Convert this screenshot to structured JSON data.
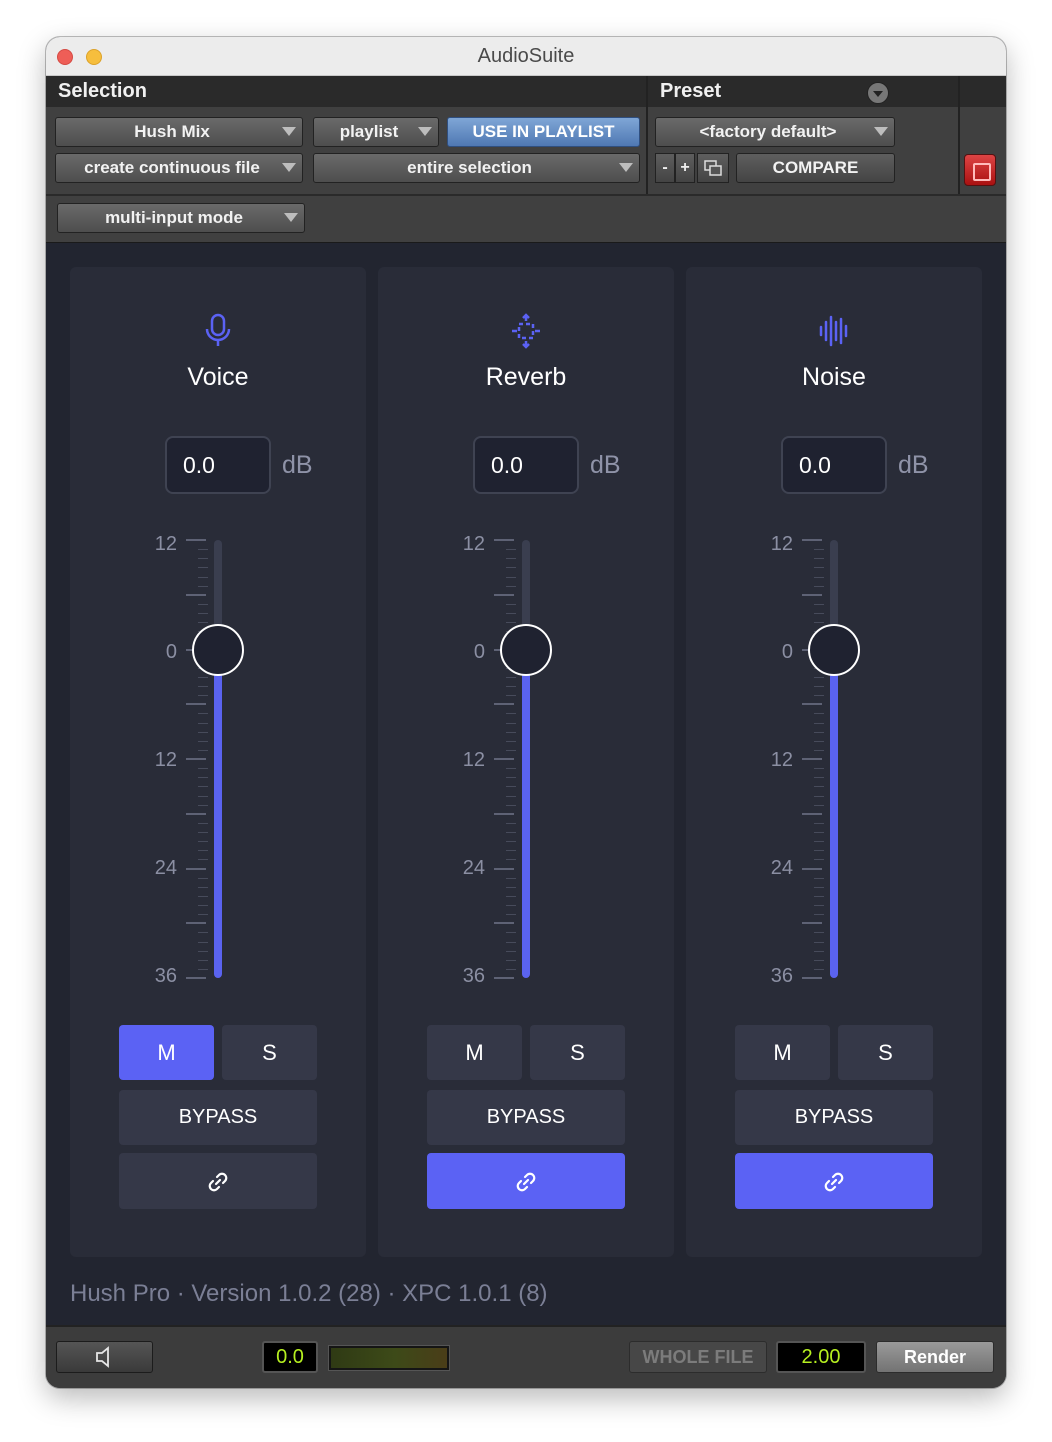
{
  "window": {
    "title": "AudioSuite"
  },
  "selection": {
    "header": "Selection",
    "plugin": "Hush Mix",
    "target": "playlist",
    "use_in_playlist": "USE IN PLAYLIST",
    "file_mode": "create continuous file",
    "processing": "entire selection",
    "input_mode": "multi-input mode"
  },
  "preset": {
    "header": "Preset",
    "name": "<factory default>",
    "minus": "-",
    "plus": "+",
    "compare": "COMPARE"
  },
  "scale_labels": [
    "12",
    "0",
    "12",
    "24",
    "36"
  ],
  "channels": [
    {
      "name": "Voice",
      "icon": "microphone-icon",
      "gain": "0.0",
      "unit": "dB",
      "level_db": 0,
      "mute": "M",
      "solo": "S",
      "mute_active": true,
      "solo_active": false,
      "bypass": "BYPASS",
      "link_active": false
    },
    {
      "name": "Reverb",
      "icon": "reverb-icon",
      "gain": "0.0",
      "unit": "dB",
      "level_db": 0,
      "mute": "M",
      "solo": "S",
      "mute_active": false,
      "solo_active": false,
      "bypass": "BYPASS",
      "link_active": true
    },
    {
      "name": "Noise",
      "icon": "waveform-icon",
      "gain": "0.0",
      "unit": "dB",
      "level_db": 0,
      "mute": "M",
      "solo": "S",
      "mute_active": false,
      "solo_active": false,
      "bypass": "BYPASS",
      "link_active": true
    }
  ],
  "version": "Hush Pro · Version 1.0.2 (28) · XPC 1.0.1 (8)",
  "bottom": {
    "gain_readout": "0.0",
    "whole_file": "WHOLE FILE",
    "handle_value": "2.00",
    "render": "Render"
  },
  "colors": {
    "accent": "#5b62f4",
    "panel": "#292c38",
    "background": "#222530",
    "lcd_text": "#b6f020"
  }
}
